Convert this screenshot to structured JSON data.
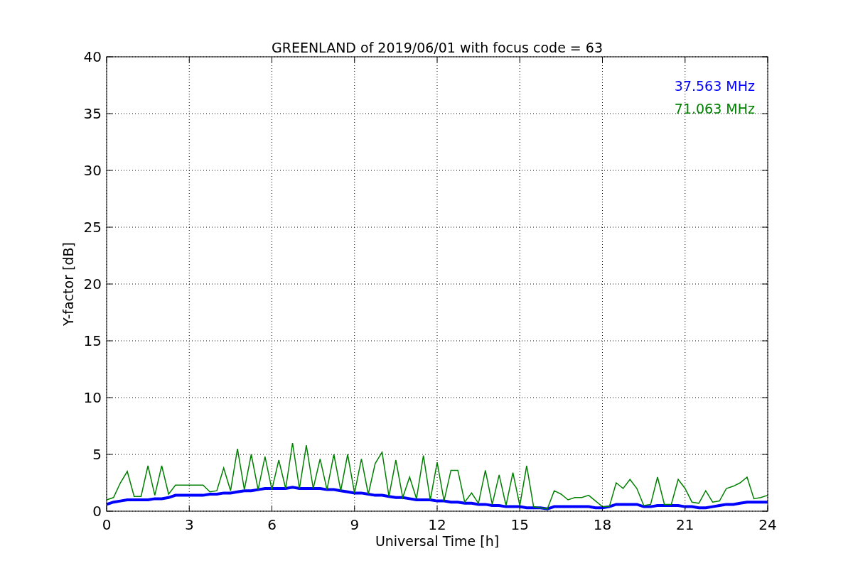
{
  "chart_data": {
    "type": "line",
    "title": "GREENLAND of 2019/06/01 with focus code = 63",
    "xlabel": "Universal Time [h]",
    "ylabel": "Y-factor [dB]",
    "x": [
      0,
      0.25,
      0.5,
      0.75,
      1,
      1.25,
      1.5,
      1.75,
      2,
      2.25,
      2.5,
      2.75,
      3,
      3.25,
      3.5,
      3.75,
      4,
      4.25,
      4.5,
      4.75,
      5,
      5.25,
      5.5,
      5.75,
      6,
      6.25,
      6.5,
      6.75,
      7,
      7.25,
      7.5,
      7.75,
      8,
      8.25,
      8.5,
      8.75,
      9,
      9.25,
      9.5,
      9.75,
      10,
      10.25,
      10.5,
      10.75,
      11,
      11.25,
      11.5,
      11.75,
      12,
      12.25,
      12.5,
      12.75,
      13,
      13.25,
      13.5,
      13.75,
      14,
      14.25,
      14.5,
      14.75,
      15,
      15.25,
      15.5,
      15.75,
      16,
      16.25,
      16.5,
      16.75,
      17,
      17.25,
      17.5,
      17.75,
      18,
      18.25,
      18.5,
      18.75,
      19,
      19.25,
      19.5,
      19.75,
      20,
      20.25,
      20.5,
      20.75,
      21,
      21.25,
      21.5,
      21.75,
      22,
      22.25,
      22.5,
      22.75,
      23,
      23.25,
      23.5,
      23.75,
      24
    ],
    "series": [
      {
        "name": "37.563 MHz",
        "color": "#0000ff",
        "values": [
          0.6,
          0.8,
          0.9,
          1.0,
          1.0,
          1.0,
          1.0,
          1.1,
          1.1,
          1.2,
          1.4,
          1.4,
          1.4,
          1.4,
          1.4,
          1.5,
          1.5,
          1.6,
          1.6,
          1.7,
          1.8,
          1.8,
          1.9,
          2.0,
          2.0,
          2.0,
          2.0,
          2.1,
          2.0,
          2.0,
          2.0,
          2.0,
          1.9,
          1.9,
          1.8,
          1.7,
          1.6,
          1.6,
          1.5,
          1.4,
          1.4,
          1.3,
          1.2,
          1.2,
          1.1,
          1.0,
          1.0,
          1.0,
          0.9,
          0.9,
          0.8,
          0.8,
          0.7,
          0.7,
          0.6,
          0.6,
          0.5,
          0.5,
          0.4,
          0.4,
          0.4,
          0.3,
          0.3,
          0.3,
          0.2,
          0.4,
          0.4,
          0.4,
          0.4,
          0.4,
          0.4,
          0.3,
          0.3,
          0.4,
          0.6,
          0.6,
          0.6,
          0.6,
          0.4,
          0.4,
          0.5,
          0.5,
          0.5,
          0.5,
          0.4,
          0.4,
          0.3,
          0.3,
          0.4,
          0.5,
          0.6,
          0.6,
          0.7,
          0.8,
          0.8,
          0.8,
          0.8
        ]
      },
      {
        "name": "71.063 MHz",
        "color": "#008000",
        "values": [
          1.0,
          1.2,
          2.5,
          3.5,
          1.3,
          1.3,
          4.0,
          1.4,
          4.0,
          1.5,
          2.3,
          2.3,
          2.3,
          2.3,
          2.3,
          1.7,
          1.8,
          3.8,
          1.8,
          5.5,
          1.9,
          5.0,
          1.9,
          4.8,
          1.9,
          4.5,
          2.0,
          6.0,
          2.0,
          5.8,
          2.0,
          4.6,
          1.9,
          5.0,
          1.8,
          5.0,
          1.6,
          4.6,
          1.5,
          4.2,
          5.2,
          1.3,
          4.5,
          1.2,
          3.0,
          1.1,
          4.9,
          1.0,
          4.3,
          0.9,
          3.6,
          3.6,
          0.8,
          1.6,
          0.7,
          3.6,
          0.6,
          3.2,
          0.5,
          3.4,
          0.5,
          4.0,
          0.4,
          0.3,
          0.2,
          1.8,
          1.5,
          1.0,
          1.2,
          1.2,
          1.4,
          0.9,
          0.4,
          0.4,
          2.5,
          2.0,
          2.8,
          2.0,
          0.5,
          0.6,
          3.0,
          0.6,
          0.6,
          2.8,
          2.0,
          0.8,
          0.7,
          1.8,
          0.8,
          0.9,
          2.0,
          2.2,
          2.5,
          3.0,
          1.1,
          1.2,
          1.4
        ]
      }
    ],
    "xlim": [
      0,
      24
    ],
    "ylim": [
      0,
      40
    ],
    "xticks": [
      0,
      3,
      6,
      9,
      12,
      15,
      18,
      21,
      24
    ],
    "yticks": [
      0,
      5,
      10,
      15,
      20,
      25,
      30,
      35,
      40
    ],
    "grid": true
  }
}
